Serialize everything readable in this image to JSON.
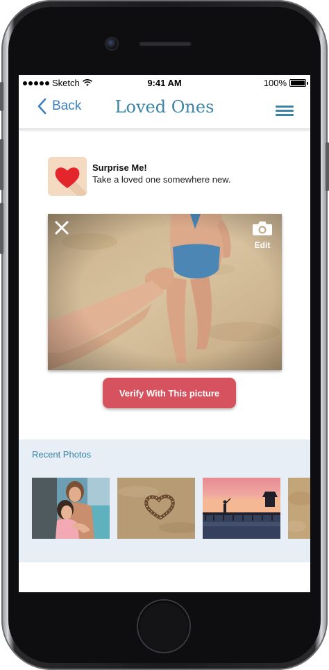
{
  "status_bar": {
    "carrier": "Sketch",
    "time": "9:41 AM",
    "battery": "100%"
  },
  "nav": {
    "back_label": "Back",
    "title": "Loved Ones"
  },
  "prompt": {
    "title": "Surprise Me!",
    "subtitle": "Take a loved one somewhere new."
  },
  "photo": {
    "edit_label": "Edit"
  },
  "verify_button_label": "Verify With This picture",
  "recent": {
    "label": "Recent Photos",
    "thumbnails": [
      "couple-photo",
      "stone-heart-photo",
      "sunset-pier-photo",
      "sand-photo"
    ]
  },
  "colors": {
    "accent": "#3b84a6",
    "back_blue": "#3c80c0",
    "verify_red": "#d5525e",
    "recent_bg": "#e7eef5"
  },
  "icons": [
    "back-chevron-icon",
    "menu-icon",
    "heart-icon",
    "close-icon",
    "camera-icon",
    "wifi-icon",
    "battery-icon"
  ]
}
